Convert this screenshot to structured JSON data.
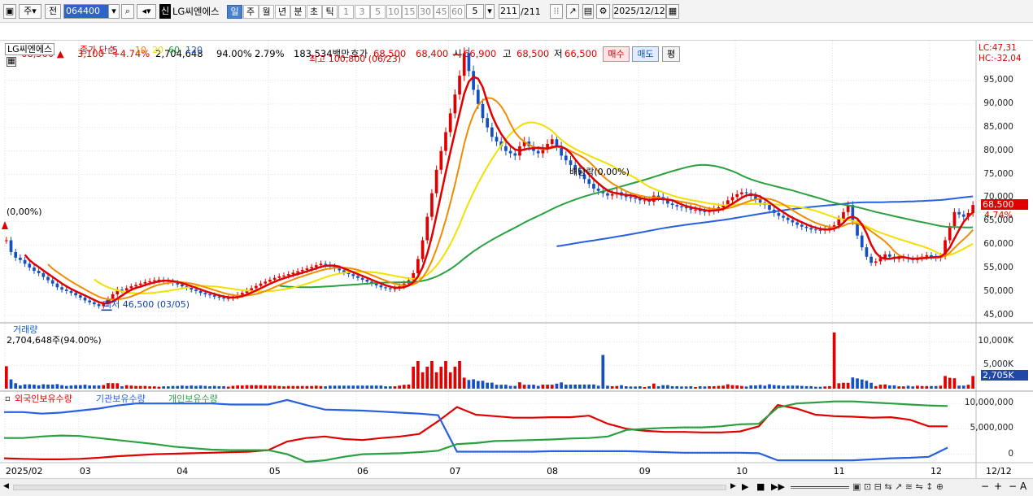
{
  "toolbar": {
    "mode": "주",
    "prev": "전",
    "code": "064400",
    "sin": "신",
    "name": "LG씨엔에스",
    "periods": [
      "일",
      "주",
      "월",
      "년",
      "분",
      "초",
      "틱"
    ],
    "intervals": [
      "1",
      "3",
      "5",
      "10",
      "15",
      "30",
      "45",
      "60"
    ],
    "count_sel": "5",
    "bars": "211",
    "bars_total": "/211",
    "date": "2025/12/12"
  },
  "quote": {
    "price": "68,500",
    "change": "3,100",
    "rate": "+4.74%",
    "volume": "2,704,648",
    "vol_ratio": "94.00%",
    "turnover": "2.79%",
    "amount": "183,534백만",
    "bid_label": "호가",
    "ask": "68,500",
    "bid": "68,400",
    "open_label": "시",
    "open": "66,900",
    "high_label": "고",
    "high": "68,500",
    "low_label": "저",
    "low": "66,500",
    "buy": "매수",
    "sell": "매도",
    "eval": "평"
  },
  "price_chart": {
    "title": "LG씨엔에스",
    "ma_label": "종가 단순",
    "ma_periods": [
      "5",
      "10",
      "20",
      "60",
      "120"
    ],
    "ma_colors": [
      "#e00000",
      "#f08c00",
      "#f2e000",
      "#2aa040",
      "#2860e0"
    ],
    "high_note": "최고 100,800 (06/23)",
    "low_note": "최저 46,500 (03/05)",
    "left_note": "(0,00%)",
    "div_note": "배당락(0,00%)",
    "lc": "LC:47,31",
    "hc": "HC:-32,04",
    "price_tag": "68,500",
    "rate_tag": "4.74%",
    "y_ticks": [
      "95,000",
      "90,000",
      "85,000",
      "80,000",
      "75,000",
      "70,000",
      "65,000",
      "60,000",
      "55,000",
      "50,000",
      "45,000"
    ]
  },
  "volume_chart": {
    "title": "거래량",
    "info": "2,704,648주(94.00%)",
    "tag": "2,705K",
    "y_ticks": [
      "10,000K",
      "5,000K"
    ]
  },
  "holding_chart": {
    "legend": [
      "외국인보유수량",
      "기관보유수량",
      "개인보유수량"
    ],
    "colors": [
      "#e00000",
      "#2860e0",
      "#2aa040"
    ],
    "y_ticks": [
      "10,000,000",
      "5,000,000",
      "0"
    ]
  },
  "x_axis": {
    "labels": [
      "2025/02",
      "03",
      "04",
      "05",
      "06",
      "07",
      "08",
      "09",
      "10",
      "11",
      "12"
    ],
    "last": "12/12"
  },
  "chart_data": {
    "type": "candlestick",
    "title": "LG씨엔에스",
    "price_ylim": [
      45000,
      100000
    ],
    "closes": [
      61000,
      58500,
      57300,
      56800,
      56000,
      55200,
      54500,
      54000,
      53200,
      52500,
      51800,
      51000,
      50500,
      50200,
      49800,
      49300,
      48800,
      48200,
      47800,
      47400,
      47000,
      47500,
      48500,
      49500,
      50500,
      50300,
      50800,
      51200,
      51500,
      51800,
      52100,
      52300,
      52500,
      52600,
      52400,
      52200,
      51900,
      51600,
      51200,
      50900,
      50500,
      50200,
      49800,
      49500,
      49300,
      49000,
      48800,
      48600,
      48700,
      49000,
      49400,
      49800,
      50300,
      50800,
      51300,
      51800,
      52200,
      52600,
      53000,
      53300,
      53500,
      53800,
      54100,
      54400,
      54700,
      55000,
      55300,
      55700,
      56000,
      55800,
      55400,
      55000,
      54600,
      54200,
      53800,
      53400,
      53000,
      52600,
      52200,
      51800,
      51400,
      51000,
      50800,
      50600,
      50800,
      51200,
      51800,
      52500,
      54000,
      57000,
      61000,
      66000,
      71000,
      76000,
      80000,
      84000,
      88000,
      92000,
      96000,
      100800,
      97000,
      93000,
      90000,
      87000,
      85000,
      83000,
      82000,
      81000,
      80000,
      79500,
      79000,
      81000,
      82000,
      81000,
      80000,
      79500,
      80500,
      81500,
      82500,
      81000,
      79000,
      78000,
      77000,
      76000,
      75000,
      74000,
      73000,
      72000,
      71500,
      71000,
      70500,
      70800,
      71200,
      70500,
      70200,
      70000,
      69800,
      69500,
      69500,
      69200,
      70500,
      70200,
      69500,
      68800,
      68500,
      68200,
      68000,
      67800,
      67500,
      67500,
      67200,
      67000,
      67300,
      67600,
      68000,
      68500,
      69500,
      70200,
      70800,
      71200,
      71000,
      70400,
      69800,
      69000,
      68500,
      67500,
      66800,
      66200,
      65800,
      65300,
      64800,
      64300,
      63900,
      63600,
      63300,
      63200,
      63100,
      63300,
      63600,
      64200,
      65500,
      67000,
      68500,
      65000,
      62000,
      59500,
      57500,
      56200,
      56500,
      57200,
      58000,
      57500,
      57000,
      57200,
      57400,
      57000,
      56800,
      57200,
      57500,
      57800,
      57500,
      57200,
      57600,
      61000,
      64000,
      67000,
      66500,
      66000,
      66800,
      68500
    ],
    "volume_ylim": [
      0,
      12500000
    ],
    "volume_last": 2704648,
    "holding_ylim": [
      -1500000,
      11000000
    ],
    "series": [
      {
        "name": "외국인보유수량",
        "values": [
          -800000,
          -900000,
          -1000000,
          -1000000,
          -900000,
          -700000,
          -400000,
          -200000,
          0,
          100000,
          200000,
          300000,
          400000,
          500000,
          800000,
          2500000,
          3200000,
          3500000,
          3000000,
          2800000,
          3200000,
          3500000,
          4000000,
          6500000,
          9300000,
          7800000,
          7500000,
          7200000,
          7200000,
          7300000,
          7300000,
          7600000,
          6000000,
          5000000,
          4600000,
          4400000,
          4400000,
          4300000,
          4300000,
          4500000,
          5500000,
          9700000,
          9000000,
          7800000,
          7500000,
          7400000,
          7200000,
          7300000,
          6800000,
          5500000,
          5500000
        ]
      },
      {
        "name": "기관보유수량",
        "values": [
          8300000,
          8300000,
          8000000,
          8200000,
          8600000,
          9000000,
          9600000,
          10000000,
          10000000,
          10000000,
          10000000,
          10000000,
          9800000,
          9800000,
          9800000,
          10700000,
          9700000,
          8800000,
          8700000,
          8600000,
          8400000,
          8200000,
          8000000,
          7700000,
          500000,
          500000,
          500000,
          500000,
          500000,
          600000,
          600000,
          600000,
          600000,
          600000,
          500000,
          400000,
          300000,
          300000,
          300000,
          300000,
          200000,
          -1200000,
          -1200000,
          -1200000,
          -1200000,
          -1200000,
          -1000000,
          -800000,
          -700000,
          -500000,
          1300000
        ]
      },
      {
        "name": "개인보유수량",
        "values": [
          3200000,
          3200000,
          3500000,
          3700000,
          3600000,
          3200000,
          2800000,
          2400000,
          2000000,
          1500000,
          1200000,
          900000,
          800000,
          800000,
          800000,
          0,
          -1500000,
          -1200000,
          -500000,
          0,
          100000,
          200000,
          400000,
          700000,
          2000000,
          2200000,
          2600000,
          2700000,
          2800000,
          2900000,
          3100000,
          3200000,
          3500000,
          4800000,
          5000000,
          5200000,
          5300000,
          5300000,
          5500000,
          5900000,
          6000000,
          9200000,
          10000000,
          10200000,
          10400000,
          10400000,
          10200000,
          10000000,
          9800000,
          9600000,
          9500000
        ]
      }
    ]
  }
}
